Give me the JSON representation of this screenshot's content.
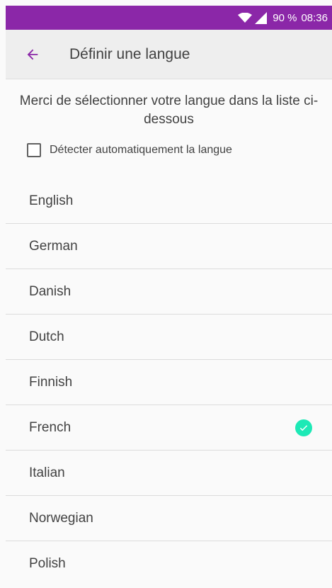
{
  "status_bar": {
    "battery": "90 %",
    "time": "08:36",
    "color": "#8b27a8"
  },
  "app_bar": {
    "title": "Définir une langue",
    "back_icon": "arrow-back-icon",
    "accent": "#8b27a8"
  },
  "instruction": "Merci de sélectionner votre langue dans la liste ci-dessous",
  "auto_detect": {
    "label": "Détecter automatiquement la langue",
    "checked": false
  },
  "languages": [
    {
      "label": "English",
      "selected": false
    },
    {
      "label": "German",
      "selected": false
    },
    {
      "label": "Danish",
      "selected": false
    },
    {
      "label": "Dutch",
      "selected": false
    },
    {
      "label": "Finnish",
      "selected": false
    },
    {
      "label": "French",
      "selected": true
    },
    {
      "label": "Italian",
      "selected": false
    },
    {
      "label": "Norwegian",
      "selected": false
    },
    {
      "label": "Polish",
      "selected": false
    }
  ],
  "selected_color": "#1de9b6"
}
